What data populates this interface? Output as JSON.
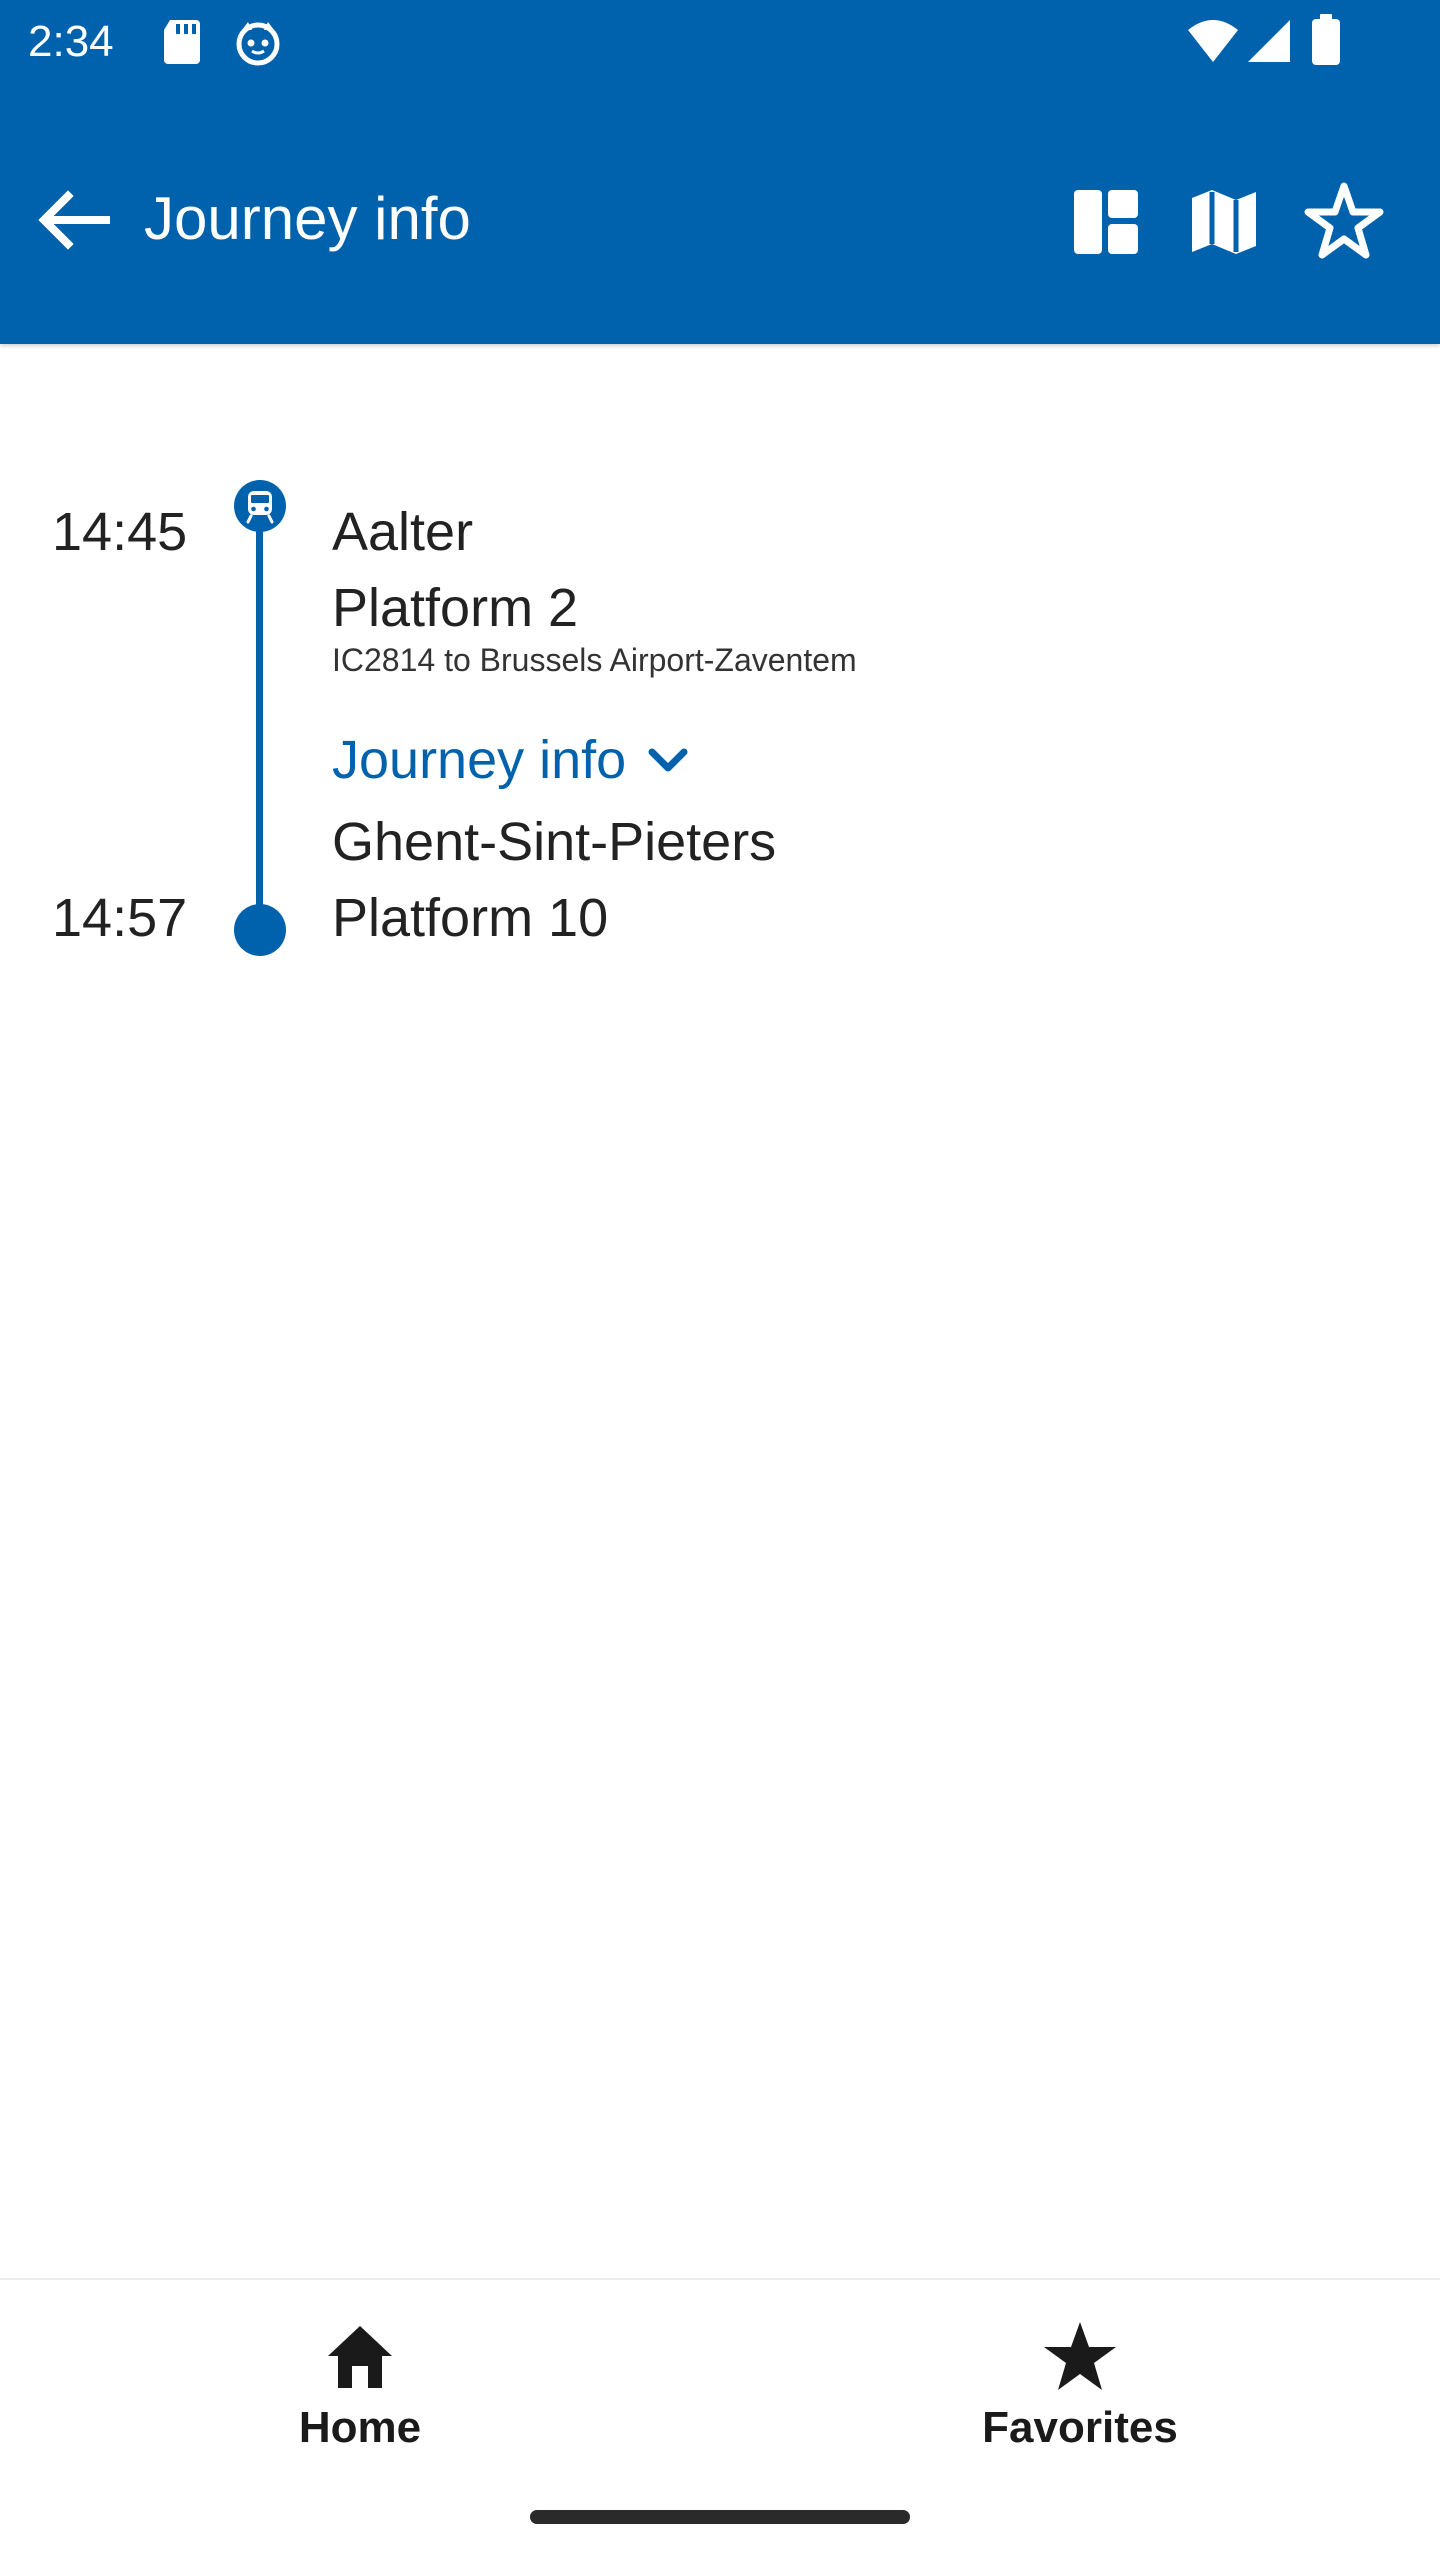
{
  "status_bar": {
    "time": "2:34",
    "icons": [
      "sd-card-icon",
      "notification-icon",
      "wifi-icon",
      "signal-icon",
      "battery-icon"
    ]
  },
  "app_bar": {
    "title": "Journey info",
    "back_icon": "arrow-back-icon",
    "actions": [
      "dashboard-icon",
      "map-icon",
      "star-outline-icon"
    ]
  },
  "journey": {
    "departure": {
      "time": "14:45",
      "station": "Aalter",
      "platform": "Platform 2",
      "train": "IC2814 to Brussels Airport-Zaventem"
    },
    "toggle": {
      "label": "Journey info",
      "icon": "chevron-down-icon"
    },
    "arrival": {
      "time": "14:57",
      "station": "Ghent-Sint-Pieters",
      "platform": "Platform 10"
    }
  },
  "bottom_nav": {
    "items": [
      {
        "label": "Home",
        "icon": "home-icon"
      },
      {
        "label": "Favorites",
        "icon": "star-icon"
      }
    ]
  },
  "colors": {
    "primary": "#0062ad",
    "text": "#222222",
    "background": "#ffffff"
  }
}
